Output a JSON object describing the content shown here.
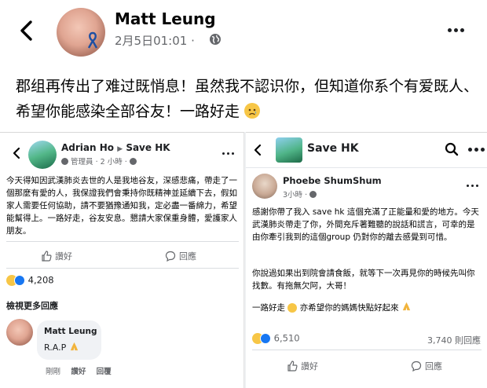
{
  "post": {
    "author": "Matt Leung",
    "time": "2月5日01:01",
    "time_separator": "·",
    "text": "郡组再传出了难过既悄息！虽然我不認识你，但知道你系个有爱既人、希望你能感染全部谷友！一路好走"
  },
  "left_card": {
    "group_author": "Adrian Ho",
    "group_name": "Save HK",
    "role": "管理員",
    "time": "2 小時",
    "body": "今天得知因武漢肺炎去世的人是我地谷友，深感悲痛，帶走了一個那麼有愛的人，我保證我們會秉持你既精神並延續下去，假如家人需要任何協助，請不要猶豫通知我，定必盡一番綿力，希望能幫得上。一路好走，谷友安息。懇請大家保重身體，愛護家人朋友。",
    "like_label": "讚好",
    "comment_label": "回應",
    "reaction_count": "4,208",
    "more_comments": "檢視更多回應",
    "reply": {
      "author": "Matt Leung",
      "text": "R.A.P",
      "time": "剛剛",
      "like": "讚好",
      "reply": "回覆"
    }
  },
  "right_card": {
    "page_name": "Save HK",
    "author": "Phoebe ShumShum",
    "time": "3小時",
    "paragraph1": "感謝你帶了我入 save hk 這個充滿了正能量和愛的地方。今天武漢肺炎帶走了你，外間充斥著難聽的說話和謊言，可幸的是由你牽引我到的這個group 仍對你的離去感覺到可惜。",
    "paragraph2": "你說過如果出到院會請食飯，就等下一次再見你的時候先叫你找數。有拖無欠阿，大哥！",
    "paragraph3": "一路好走",
    "paragraph3b": "亦希望你的媽媽快點好起來",
    "reaction_count": "6,510",
    "comment_count": "3,740 則回應",
    "like_label": "讚好",
    "comment_label": "回應"
  },
  "colors": {
    "link_blue": "#1877f2",
    "text_gray": "#65676b",
    "reaction_yellow": "#f7c646"
  },
  "icons": [
    "back-chevron-icon",
    "globe-icon",
    "more-icon",
    "ribbon-icon",
    "like-icon",
    "comment-icon",
    "sad-reaction-icon",
    "like-reaction-icon",
    "search-icon",
    "pray-icon"
  ]
}
